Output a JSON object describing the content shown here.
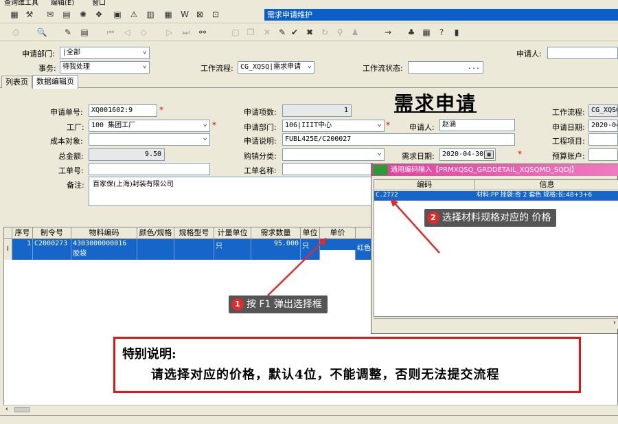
{
  "menubar": {
    "items": [
      "查询维工具",
      "编辑(E)",
      "窗口"
    ]
  },
  "window_title": "需求申请维护",
  "filter": {
    "dept_label": "申请部门:",
    "dept_value": "|全部",
    "task_label": "事务:",
    "task_value": "待我处理",
    "workflow_label": "工作流程:",
    "workflow_value": "CG_XQSQ|需求申请",
    "wf_status_label": "工作流状态:",
    "wf_status_value": "",
    "wf_status_btn": "...",
    "applicant_label": "申请人:"
  },
  "tabs": [
    {
      "label": "列表页"
    },
    {
      "label": "数据编辑页"
    }
  ],
  "form": {
    "title": "需求申请",
    "order_no_label": "申请单号:",
    "order_no": "XQ001602:9",
    "factory_label": "工厂:",
    "factory": "100 集团工厂",
    "cost_label": "成本对象:",
    "cost": "",
    "total_label": "总金额:",
    "total": "9.50",
    "work_no_label": "工单号:",
    "work_no": "",
    "remark_label": "备注:",
    "remark": "百家保(上海)封装有限公司",
    "count_label": "申请项数:",
    "count": "1",
    "apply_dept_label": "申请部门:",
    "apply_dept": "106|IIIT中心",
    "applicant_label": "申请人:",
    "applicant": "赵涵",
    "desc_label": "申请说明:",
    "desc": "FUBL425E/C200027",
    "purchase_type_label": "购销分类:",
    "purchase_type": "",
    "demand_date_label": "需求日期:",
    "demand_date": "2020-04-30",
    "work_name_label": "工单名称:",
    "work_name": "",
    "r_workflow_label": "工作流程:",
    "r_workflow": "CG_XQSQ",
    "apply_date_label": "申请日期:",
    "apply_date": "2020-04-",
    "project_label": "工程项目:",
    "project": "",
    "budget_label": "预算账户:",
    "budget": ""
  },
  "grid": {
    "columns": [
      "序号",
      "制令号",
      "物料编码",
      "颜色/规格",
      "规格型号",
      "计量单位",
      "需求数量",
      "单位",
      "单价"
    ],
    "rows": [
      {
        "marker": "I",
        "seq": "1",
        "order": "C2000273",
        "code": "4303000000016",
        "name": "胶袋",
        "color": "",
        "spec": "",
        "uom": "只",
        "qty": "95.000",
        "unit": "只",
        "price": "",
        "extra": "红色"
      }
    ]
  },
  "popup": {
    "title": "通用编码输入【PRMXQSQ_GRDDETAIL_XQSQMD_SQDJ】",
    "col_code": "编码",
    "col_info": "信息",
    "row_code": "C.2772",
    "row_info": "材料:PP 挂袋:否 2 套色 规格:长:48+3+6"
  },
  "callouts": [
    {
      "num": "1",
      "text": "按 F1 弹出选择框"
    },
    {
      "num": "2",
      "text": "选择材料规格对应的 价格"
    }
  ],
  "note": {
    "heading": "特别说明:",
    "body": "请选择对应的价格，默认4位，不能调整，否则无法提交流程"
  },
  "colors": {
    "selection": "#1566c8",
    "accent_red": "#e01515",
    "title_bar": "#0a5fc9"
  }
}
